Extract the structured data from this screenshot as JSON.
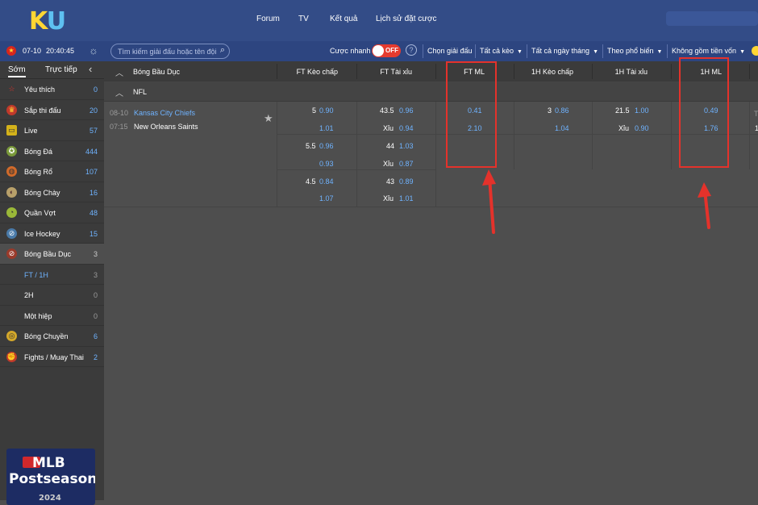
{
  "brand": {
    "logo_k": "K",
    "logo_u": "U"
  },
  "nav": [
    "Forum",
    "TV",
    "Kết quả",
    "Lịch sử đặt cược"
  ],
  "subbar": {
    "date": "07-10",
    "time": "20:40:45",
    "search_placeholder": "Tìm kiếm giải đấu hoặc tên đội",
    "quick_bet": "Cược nhanh",
    "toggle": "OFF",
    "help": "?",
    "filters": [
      "Chọn giải đấu",
      "Tất cả kèo",
      "Tất cả ngày tháng",
      "Theo phổ biến",
      "Không gồm tiền vốn"
    ]
  },
  "sidebar": {
    "tabs": [
      "Sớm",
      "Trực tiếp"
    ],
    "items": [
      {
        "label": "Yêu thích",
        "count": "0",
        "icon": "star-icon"
      },
      {
        "label": "Sắp thi đấu",
        "count": "20",
        "icon": "trophy-icon"
      },
      {
        "label": "Live",
        "count": "57",
        "icon": "tv-icon"
      },
      {
        "label": "Bóng Đá",
        "count": "444",
        "icon": "soccer-icon"
      },
      {
        "label": "Bóng Rổ",
        "count": "107",
        "icon": "basketball-icon"
      },
      {
        "label": "Bóng Chày",
        "count": "16",
        "icon": "baseball-icon"
      },
      {
        "label": "Quần Vợt",
        "count": "48",
        "icon": "tennis-icon"
      },
      {
        "label": "Ice Hockey",
        "count": "15",
        "icon": "hockey-icon"
      },
      {
        "label": "Bóng Bầu Dục",
        "count": "3",
        "icon": "football-icon"
      },
      {
        "label": "FT / 1H",
        "count": "3",
        "icon": ""
      },
      {
        "label": "2H",
        "count": "0",
        "icon": ""
      },
      {
        "label": "Một hiệp",
        "count": "0",
        "icon": ""
      },
      {
        "label": "Bóng Chuyền",
        "count": "6",
        "icon": "volleyball-icon"
      },
      {
        "label": "Fights / Muay Thai",
        "count": "2",
        "icon": "boxing-icon"
      }
    ],
    "banner": {
      "line1": "MLB",
      "line2": "Postseason",
      "line3": "2024"
    }
  },
  "table": {
    "headers": [
      "Bóng Bầu Dục",
      "FT Kèo chấp",
      "FT Tài xỉu",
      "FT ML",
      "1H Kèo chấp",
      "1H Tài xỉu",
      "1H ML",
      "T"
    ],
    "league": "NFL",
    "match": {
      "date": "08-10",
      "time": "07:15",
      "home": "Kansas City Chiefs",
      "away": "New Orleans Saints"
    },
    "rows": [
      {
        "hcap_line": "5",
        "hcap_odds": "0.90",
        "ou_line": "43.5",
        "ou_odds": "0.96",
        "ml": "0.41",
        "h1_hcap_line": "3",
        "h1_hcap_odds": "0.86",
        "h1_ou_line": "21.5",
        "h1_ou_odds": "1.00",
        "h1_ml": "0.49"
      },
      {
        "hcap_line": "",
        "hcap_odds": "1.01",
        "ou_line": "Xỉu",
        "ou_odds": "0.94",
        "ml": "2.10",
        "h1_hcap_line": "",
        "h1_hcap_odds": "1.04",
        "h1_ou_line": "Xỉu",
        "h1_ou_odds": "0.90",
        "h1_ml": "1.76"
      },
      {
        "hcap_line": "5.5",
        "hcap_odds": "0.96",
        "ou_line": "44",
        "ou_odds": "1.03"
      },
      {
        "hcap_line": "",
        "hcap_odds": "0.93",
        "ou_line": "Xỉu",
        "ou_odds": "0.87"
      },
      {
        "hcap_line": "4.5",
        "hcap_odds": "0.84",
        "ou_line": "43",
        "ou_odds": "0.89"
      },
      {
        "hcap_line": "",
        "hcap_odds": "1.07",
        "ou_line": "Xỉu",
        "ou_odds": "1.01"
      }
    ]
  },
  "colors": {
    "accent_red": "#e4322b",
    "odds_blue": "#6fb3ff",
    "top_bar": "#334c87"
  }
}
